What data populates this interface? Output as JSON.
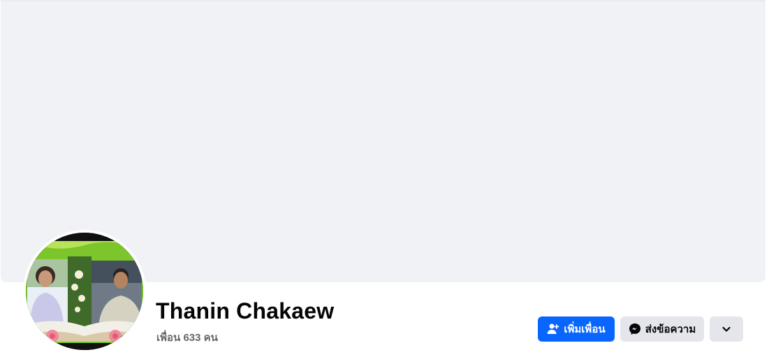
{
  "profile": {
    "name": "Thanin Chakaew",
    "friends_text": "เพื่อน 633 คน"
  },
  "actions": {
    "add_friend_label": "เพิ่มเพื่อน",
    "message_label": "ส่งข้อความ"
  },
  "colors": {
    "cover_bg": "#f0f2f5",
    "primary_button": "#0866ff",
    "secondary_button": "#e4e6eb",
    "subtext": "#65676b"
  },
  "icons": {
    "add_friend": "person-plus-icon",
    "message": "messenger-icon",
    "more": "chevron-down-icon"
  }
}
